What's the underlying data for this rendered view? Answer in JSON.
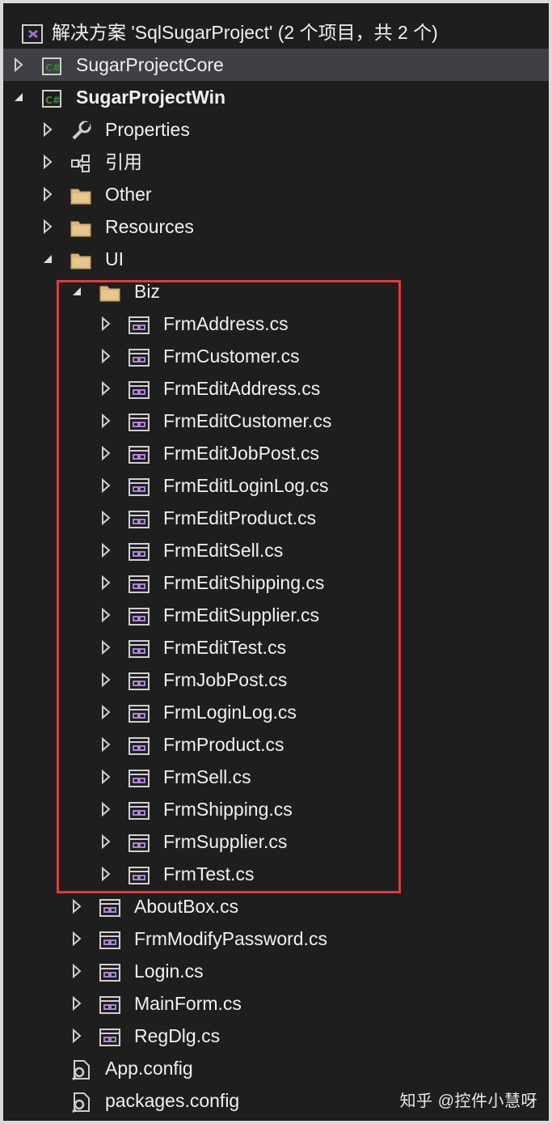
{
  "solution": {
    "title": "解决方案 'SqlSugarProject' (2 个项目，共 2 个)"
  },
  "nodes": [
    {
      "label": "SugarProjectCore",
      "icon": "csharp-project-icon",
      "expand": "collapsed",
      "level": 0,
      "selected": true
    },
    {
      "label": "SugarProjectWin",
      "icon": "csharp-project-icon",
      "expand": "expanded",
      "level": 0,
      "bold": true
    },
    {
      "label": "Properties",
      "icon": "wrench-icon",
      "expand": "collapsed",
      "level": 1
    },
    {
      "label": "引用",
      "icon": "references-icon",
      "expand": "collapsed",
      "level": 1
    },
    {
      "label": "Other",
      "icon": "folder-icon",
      "expand": "collapsed",
      "level": 1
    },
    {
      "label": "Resources",
      "icon": "folder-icon",
      "expand": "collapsed",
      "level": 1
    },
    {
      "label": "UI",
      "icon": "folder-icon",
      "expand": "expanded",
      "level": 1
    },
    {
      "label": "Biz",
      "icon": "folder-icon",
      "expand": "expanded",
      "level": 2
    },
    {
      "label": "FrmAddress.cs",
      "icon": "form-icon",
      "expand": "collapsed",
      "level": 3
    },
    {
      "label": "FrmCustomer.cs",
      "icon": "form-icon",
      "expand": "collapsed",
      "level": 3
    },
    {
      "label": "FrmEditAddress.cs",
      "icon": "form-icon",
      "expand": "collapsed",
      "level": 3
    },
    {
      "label": "FrmEditCustomer.cs",
      "icon": "form-icon",
      "expand": "collapsed",
      "level": 3
    },
    {
      "label": "FrmEditJobPost.cs",
      "icon": "form-icon",
      "expand": "collapsed",
      "level": 3
    },
    {
      "label": "FrmEditLoginLog.cs",
      "icon": "form-icon",
      "expand": "collapsed",
      "level": 3
    },
    {
      "label": "FrmEditProduct.cs",
      "icon": "form-icon",
      "expand": "collapsed",
      "level": 3
    },
    {
      "label": "FrmEditSell.cs",
      "icon": "form-icon",
      "expand": "collapsed",
      "level": 3
    },
    {
      "label": "FrmEditShipping.cs",
      "icon": "form-icon",
      "expand": "collapsed",
      "level": 3
    },
    {
      "label": "FrmEditSupplier.cs",
      "icon": "form-icon",
      "expand": "collapsed",
      "level": 3
    },
    {
      "label": "FrmEditTest.cs",
      "icon": "form-icon",
      "expand": "collapsed",
      "level": 3
    },
    {
      "label": "FrmJobPost.cs",
      "icon": "form-icon",
      "expand": "collapsed",
      "level": 3
    },
    {
      "label": "FrmLoginLog.cs",
      "icon": "form-icon",
      "expand": "collapsed",
      "level": 3
    },
    {
      "label": "FrmProduct.cs",
      "icon": "form-icon",
      "expand": "collapsed",
      "level": 3
    },
    {
      "label": "FrmSell.cs",
      "icon": "form-icon",
      "expand": "collapsed",
      "level": 3
    },
    {
      "label": "FrmShipping.cs",
      "icon": "form-icon",
      "expand": "collapsed",
      "level": 3
    },
    {
      "label": "FrmSupplier.cs",
      "icon": "form-icon",
      "expand": "collapsed",
      "level": 3
    },
    {
      "label": "FrmTest.cs",
      "icon": "form-icon",
      "expand": "collapsed",
      "level": 3
    },
    {
      "label": "AboutBox.cs",
      "icon": "form-icon",
      "expand": "collapsed",
      "level": 2
    },
    {
      "label": "FrmModifyPassword.cs",
      "icon": "form-icon",
      "expand": "collapsed",
      "level": 2
    },
    {
      "label": "Login.cs",
      "icon": "form-icon",
      "expand": "collapsed",
      "level": 2
    },
    {
      "label": "MainForm.cs",
      "icon": "form-icon",
      "expand": "collapsed",
      "level": 2
    },
    {
      "label": "RegDlg.cs",
      "icon": "form-icon",
      "expand": "collapsed",
      "level": 2
    },
    {
      "label": "App.config",
      "icon": "config-icon",
      "expand": "none",
      "level": 1
    },
    {
      "label": "packages.config",
      "icon": "config-icon",
      "expand": "none",
      "level": 1
    }
  ],
  "watermark": "知乎 @控件小慧呀",
  "colors": {
    "background": "#1e1e1e",
    "selected_row": "#3f3f46",
    "highlight_border": "#e0393e",
    "folder": "#dcb67a",
    "form_icon": "#b180d7",
    "csharp_icon": "#388a34"
  }
}
